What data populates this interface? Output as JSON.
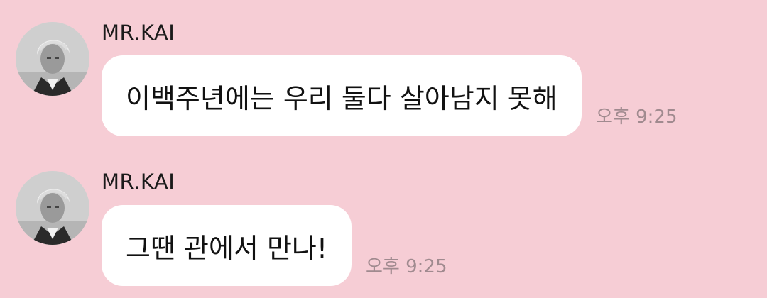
{
  "chat": {
    "messages": [
      {
        "sender": "MR.KAI",
        "text": "이백주년에는 우리 둘다 살아남지 못해",
        "time": "오후 9:25"
      },
      {
        "sender": "MR.KAI",
        "text": "그땐 관에서 만나!",
        "time": "오후 9:25"
      }
    ]
  },
  "colors": {
    "background": "#f6cdd5",
    "bubble": "#ffffff",
    "timestamp": "#a08a8f"
  },
  "icons": {
    "avatar": "profile-photo"
  }
}
